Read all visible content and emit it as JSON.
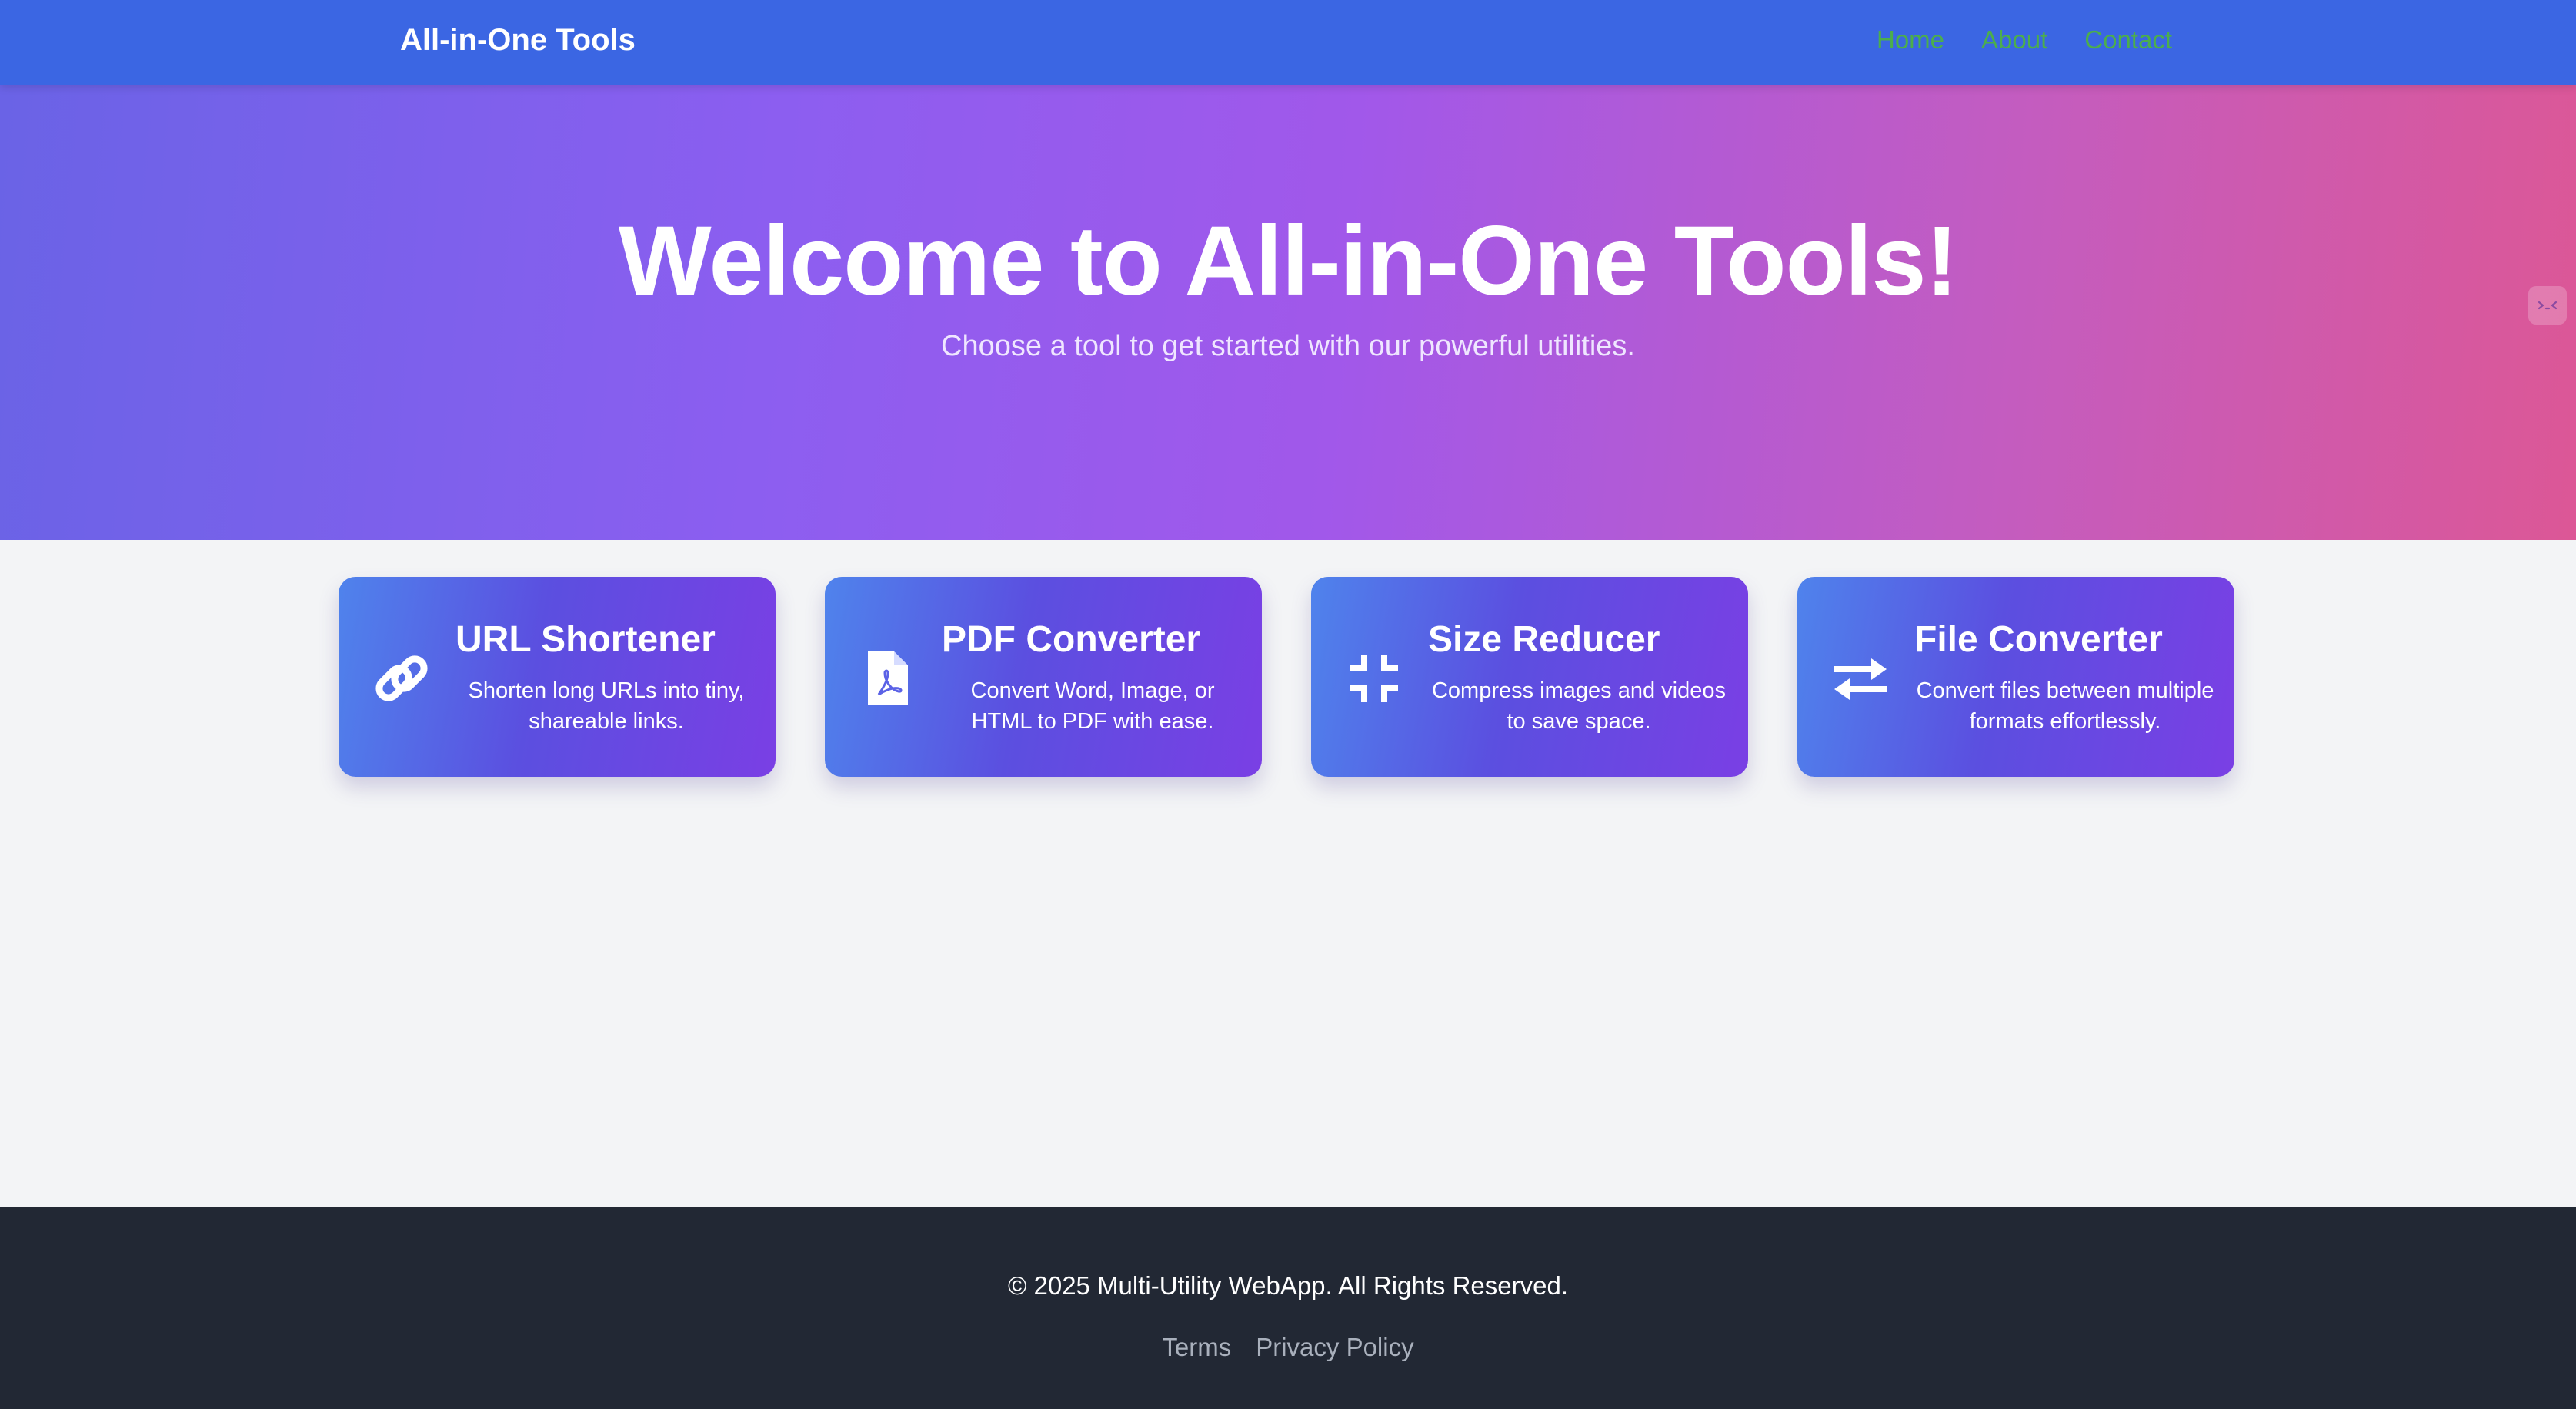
{
  "nav": {
    "brand": "All-in-One Tools",
    "links": [
      "Home",
      "About",
      "Contact"
    ]
  },
  "hero": {
    "title": "Welcome to All-in-One Tools!",
    "subtitle": "Choose a tool to get started with our powerful utilities.",
    "toggle_icon": "code-icon"
  },
  "tools": [
    {
      "icon": "link-icon",
      "title": "URL Shortener",
      "description": "Shorten long URLs into tiny, shareable links."
    },
    {
      "icon": "file-pdf-icon",
      "title": "PDF Converter",
      "description": "Convert Word, Image, or HTML to PDF with ease."
    },
    {
      "icon": "compress-icon",
      "title": "Size Reducer",
      "description": "Compress images and videos to save space."
    },
    {
      "icon": "exchange-arrows-icon",
      "title": "File Converter",
      "description": "Convert files between multiple formats effortlessly."
    }
  ],
  "footer": {
    "copyright": "© 2025 Multi-Utility WebApp. All Rights Reserved.",
    "links": [
      "Terms",
      "Privacy Policy"
    ]
  },
  "colors": {
    "nav_bg": "#3b66e3",
    "nav_link": "#4cae4c",
    "hero_gradient_start": "#6a63e6",
    "hero_gradient_end": "#dc5796",
    "card_gradient_start": "#4f83ec",
    "card_gradient_end": "#7a3fe4",
    "footer_bg": "#222834"
  }
}
